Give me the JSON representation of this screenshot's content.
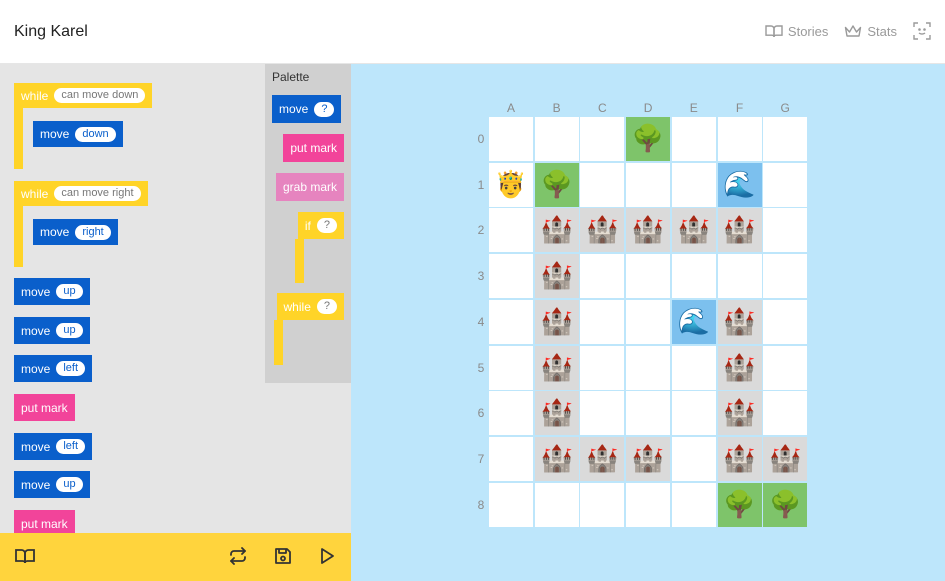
{
  "app": {
    "title": "King Karel"
  },
  "nav": {
    "stories": "Stories",
    "stats": "Stats"
  },
  "program": {
    "while1": {
      "label": "while",
      "cond": "can move down"
    },
    "while1_body": {
      "label": "move",
      "arg": "down"
    },
    "while2": {
      "label": "while",
      "cond": "can move right"
    },
    "while2_body": {
      "label": "move",
      "arg": "right"
    },
    "b1": {
      "label": "move",
      "arg": "up"
    },
    "b2": {
      "label": "move",
      "arg": "up"
    },
    "b3": {
      "label": "move",
      "arg": "left"
    },
    "b4": {
      "label": "put mark"
    },
    "b5": {
      "label": "move",
      "arg": "left"
    },
    "b6": {
      "label": "move",
      "arg": "up"
    },
    "b7": {
      "label": "put mark"
    }
  },
  "palette": {
    "title": "Palette",
    "move": {
      "label": "move",
      "arg": "?"
    },
    "put_mark": {
      "label": "put mark"
    },
    "grab_mark": {
      "label": "grab mark"
    },
    "if": {
      "label": "if",
      "arg": "?"
    },
    "while": {
      "label": "while",
      "arg": "?"
    }
  },
  "grid": {
    "columns": [
      "A",
      "B",
      "C",
      "D",
      "E",
      "F",
      "G"
    ],
    "rows": [
      "0",
      "1",
      "2",
      "3",
      "4",
      "5",
      "6",
      "7",
      "8"
    ],
    "glyphs": {
      "castle": "🏰",
      "tree": "🌳",
      "water": "🌊",
      "king": "🤴"
    },
    "cells": [
      [
        "",
        "",
        "",
        "tree",
        "",
        "",
        ""
      ],
      [
        "king",
        "tree",
        "",
        "",
        "",
        "water",
        ""
      ],
      [
        "",
        "castle",
        "castle",
        "castle",
        "castle",
        "castle",
        ""
      ],
      [
        "",
        "castle",
        "",
        "",
        "",
        "",
        ""
      ],
      [
        "",
        "castle",
        "",
        "",
        "water",
        "castle",
        ""
      ],
      [
        "",
        "castle",
        "",
        "",
        "",
        "castle",
        ""
      ],
      [
        "",
        "castle",
        "",
        "",
        "",
        "castle",
        ""
      ],
      [
        "",
        "castle",
        "castle",
        "castle",
        "",
        "castle",
        "castle"
      ],
      [
        "",
        "",
        "",
        "",
        "",
        "tree",
        "tree"
      ]
    ]
  },
  "icons": {
    "stories": "book-open-icon",
    "stats": "crown-icon",
    "fullscreen": "focus-frame-icon",
    "book": "book-open-icon",
    "reset": "repeat-icon",
    "save": "save-icon",
    "run": "play-icon"
  },
  "colors": {
    "move_block": "#0a5fcb",
    "put_mark_block": "#f2449a",
    "grab_mark_block": "#e684bf",
    "control_block": "#ffd428",
    "world_bg": "#bde6fb",
    "castle_cell": "#dadada",
    "tree_cell": "#7ec46a",
    "water_cell": "#7cc0ee"
  }
}
